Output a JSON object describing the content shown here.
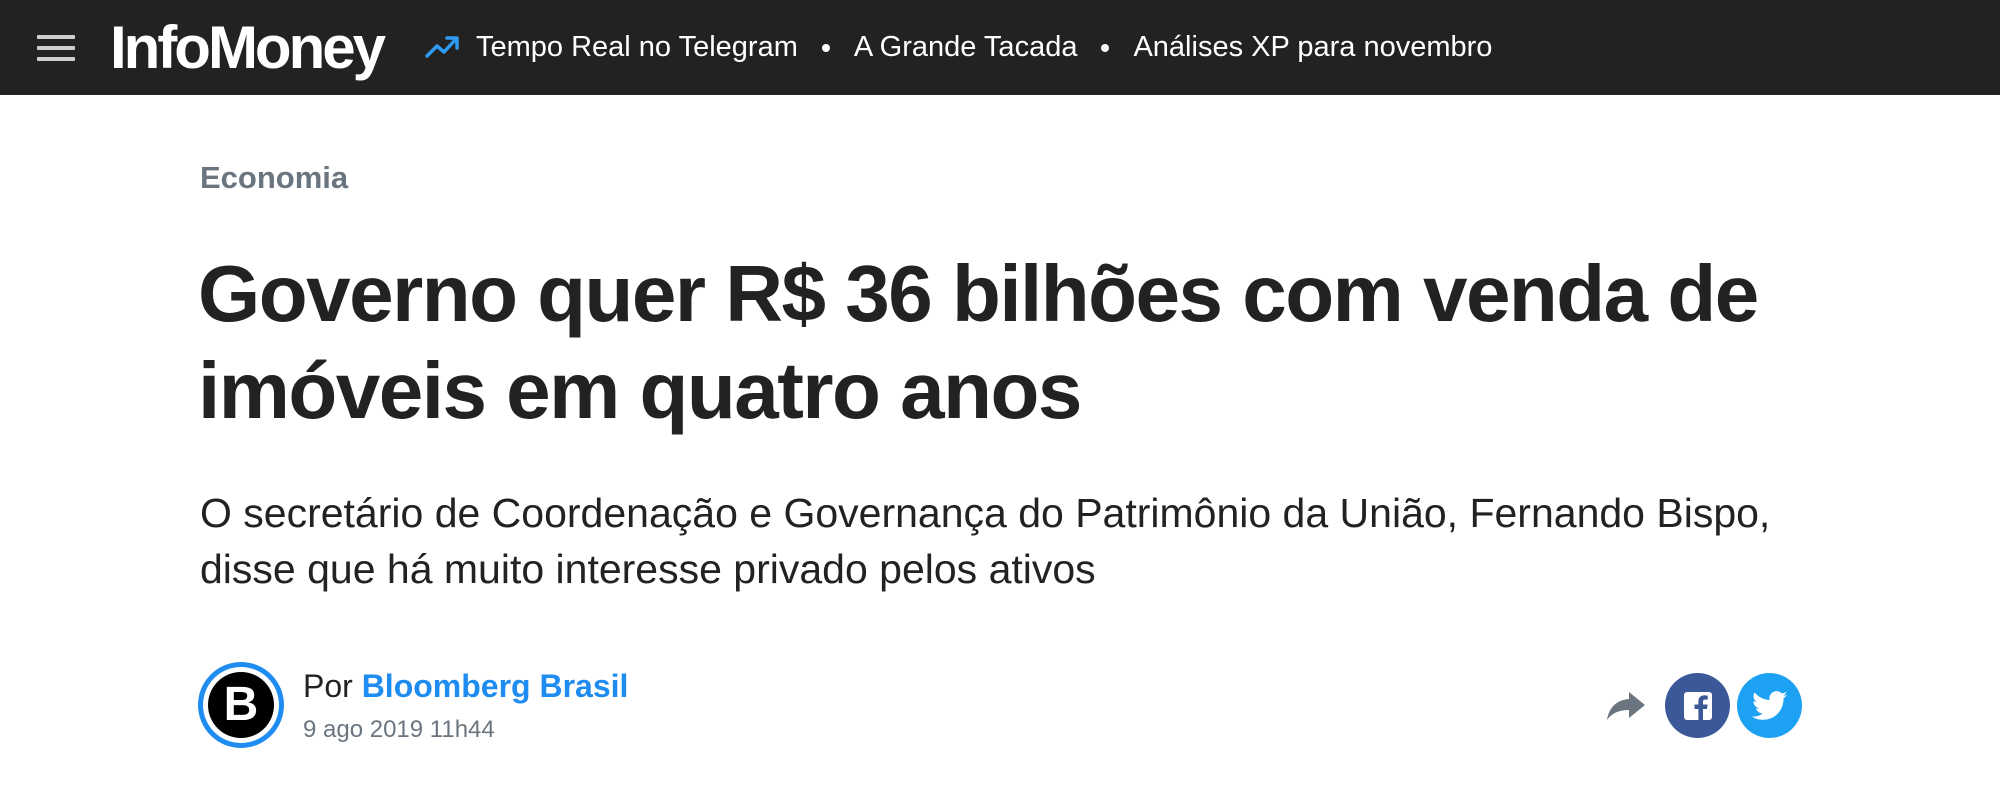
{
  "header": {
    "logo_text": "InfoMoney",
    "nav": [
      {
        "label": "Tempo Real no Telegram"
      },
      {
        "label": "A Grande Tacada"
      },
      {
        "label": "Análises XP para novembro"
      }
    ],
    "background_color": "#222222",
    "accent_icon_color": "#2f9bf3"
  },
  "article": {
    "category": "Economia",
    "headline": "Governo quer R$ 36 bilhões com venda de imóveis em quatro anos",
    "subtitle": "O secretário de Coordenação e Governança do Patrimônio da União, Fernando Bispo, disse que há muito interesse privado pelos ativos",
    "author": {
      "avatar_letter": "B",
      "by_prefix": "Por",
      "name": "Bloomberg Brasil",
      "date": "9 ago 2019 11h44"
    },
    "share": {
      "share_icon": "share-arrow-icon",
      "facebook_icon": "facebook-icon",
      "twitter_icon": "twitter-icon",
      "facebook_color": "#3b5998",
      "twitter_color": "#1da1f2"
    },
    "link_color": "#1e8cf0"
  }
}
